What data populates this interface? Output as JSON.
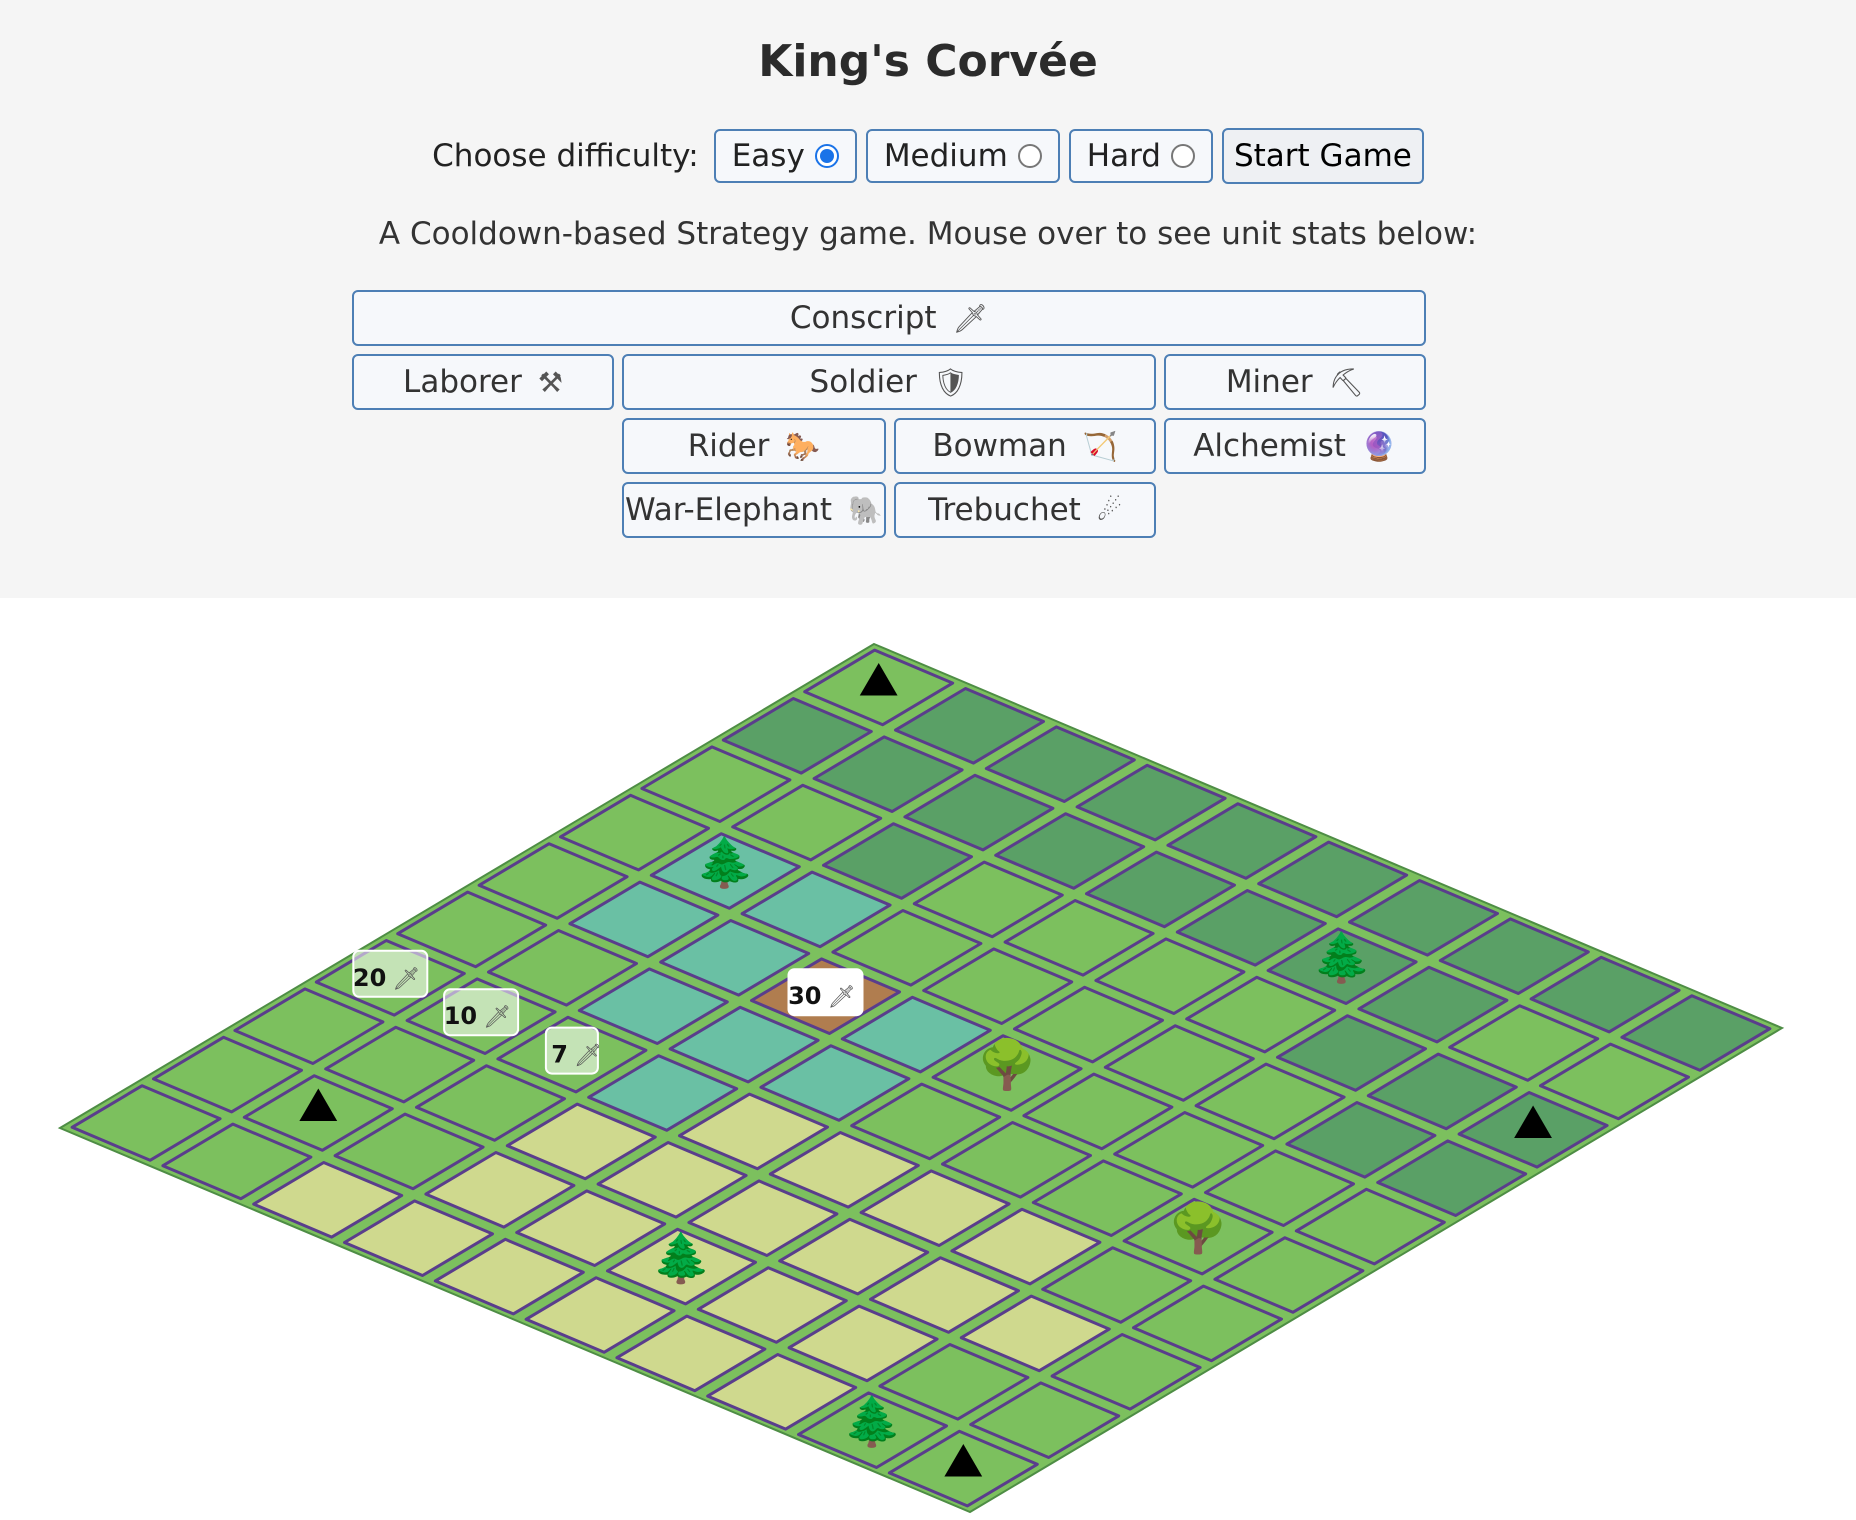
{
  "header": {
    "title": "King's Corvée",
    "difficulty_label": "Choose difficulty:",
    "difficulty_options": [
      {
        "label": "Easy",
        "selected": true
      },
      {
        "label": "Medium",
        "selected": false
      },
      {
        "label": "Hard",
        "selected": false
      }
    ],
    "start_label": "Start Game",
    "subtitle": "A Cooldown-based Strategy game. Mouse over to see unit stats below:"
  },
  "units": {
    "conscript": {
      "label": "Conscript",
      "icon": "dagger-icon",
      "glyph": "🗡"
    },
    "laborer": {
      "label": "Laborer",
      "icon": "hammer-wrench-icon",
      "glyph": "⚒"
    },
    "soldier": {
      "label": "Soldier",
      "icon": "shield-icon",
      "glyph": "🛡"
    },
    "miner": {
      "label": "Miner",
      "icon": "pick-icon",
      "glyph": "⛏"
    },
    "rider": {
      "label": "Rider",
      "icon": "horse-icon",
      "glyph": "🐎"
    },
    "bowman": {
      "label": "Bowman",
      "icon": "bow-arrow-icon",
      "glyph": "🏹"
    },
    "alchemist": {
      "label": "Alchemist",
      "icon": "crystal-ball-icon",
      "glyph": "🔮"
    },
    "war_elephant": {
      "label": "War-Elephant",
      "icon": "elephant-icon",
      "glyph": "🐘"
    },
    "trebuchet": {
      "label": "Trebuchet",
      "icon": "comet-icon",
      "glyph": "☄"
    }
  },
  "board": {
    "size": 10,
    "colors": {
      "grass": "#7cc05e",
      "dark_grass": "#5aa066",
      "water": "#6ac0a4",
      "plains": "#cfd98e",
      "dirt": "#b07d4f",
      "outline": "#5a3d8c",
      "background": "#ffffff"
    },
    "terrain": [
      [
        "M",
        "D",
        "D",
        "D",
        "D",
        "D",
        "D",
        "D",
        "D",
        "D"
      ],
      [
        "D",
        "D",
        "D",
        "D",
        "D",
        "D",
        "D",
        "D",
        "G",
        "G"
      ],
      [
        "G",
        "G",
        "D",
        "G",
        "G",
        "G",
        "G",
        "D",
        "D",
        "D"
      ],
      [
        "G",
        "W",
        "W",
        "G",
        "G",
        "G",
        "G",
        "G",
        "D",
        "D"
      ],
      [
        "G",
        "W",
        "W",
        "U",
        "W",
        "G",
        "G",
        "G",
        "G",
        "G"
      ],
      [
        "G",
        "G",
        "W",
        "W",
        "W",
        "G",
        "G",
        "G",
        "G",
        "G"
      ],
      [
        "G",
        "G",
        "G",
        "W",
        "P",
        "P",
        "P",
        "P",
        "G",
        "G"
      ],
      [
        "G",
        "G",
        "G",
        "P",
        "P",
        "P",
        "P",
        "P",
        "P",
        "G"
      ],
      [
        "G",
        "G",
        "G",
        "P",
        "P",
        "P",
        "P",
        "P",
        "G",
        "G"
      ],
      [
        "G",
        "G",
        "P",
        "P",
        "P",
        "P",
        "P",
        "P",
        "G",
        "M"
      ]
    ],
    "features": [
      {
        "row": 0,
        "col": 0,
        "icon": "mountain-icon",
        "glyph": "⛰"
      },
      {
        "row": 1,
        "col": 6,
        "icon": "pine-tree-icon",
        "glyph": "🌲"
      },
      {
        "row": 2,
        "col": 9,
        "icon": "mountain-icon",
        "glyph": "⛰"
      },
      {
        "row": 3,
        "col": 1,
        "icon": "pine-tree-icon",
        "glyph": "🌲"
      },
      {
        "row": 4,
        "col": 5,
        "icon": "round-tree-icon",
        "glyph": "🌳"
      },
      {
        "row": 5,
        "col": 8,
        "icon": "round-tree-icon",
        "glyph": "🌳"
      },
      {
        "row": 8,
        "col": 1,
        "icon": "mountain-icon",
        "glyph": "⛰"
      },
      {
        "row": 8,
        "col": 5,
        "icon": "pine-tree-icon",
        "glyph": "🌲"
      },
      {
        "row": 9,
        "col": 8,
        "icon": "pine-tree-icon",
        "glyph": "🌲"
      },
      {
        "row": 9,
        "col": 9,
        "icon": "mountain-icon",
        "glyph": "⛰"
      }
    ],
    "unit_markers": [
      {
        "row": 4,
        "col": 3,
        "count": "30",
        "glyph": "🗡",
        "style": "solid"
      },
      {
        "row": 6,
        "col": 0,
        "count": "20",
        "glyph": "🗡",
        "style": "faded"
      },
      {
        "row": 6,
        "col": 1,
        "count": "10",
        "glyph": "🗡",
        "style": "faded"
      },
      {
        "row": 6,
        "col": 2,
        "count": "7",
        "glyph": "🗡",
        "style": "faded"
      }
    ]
  }
}
